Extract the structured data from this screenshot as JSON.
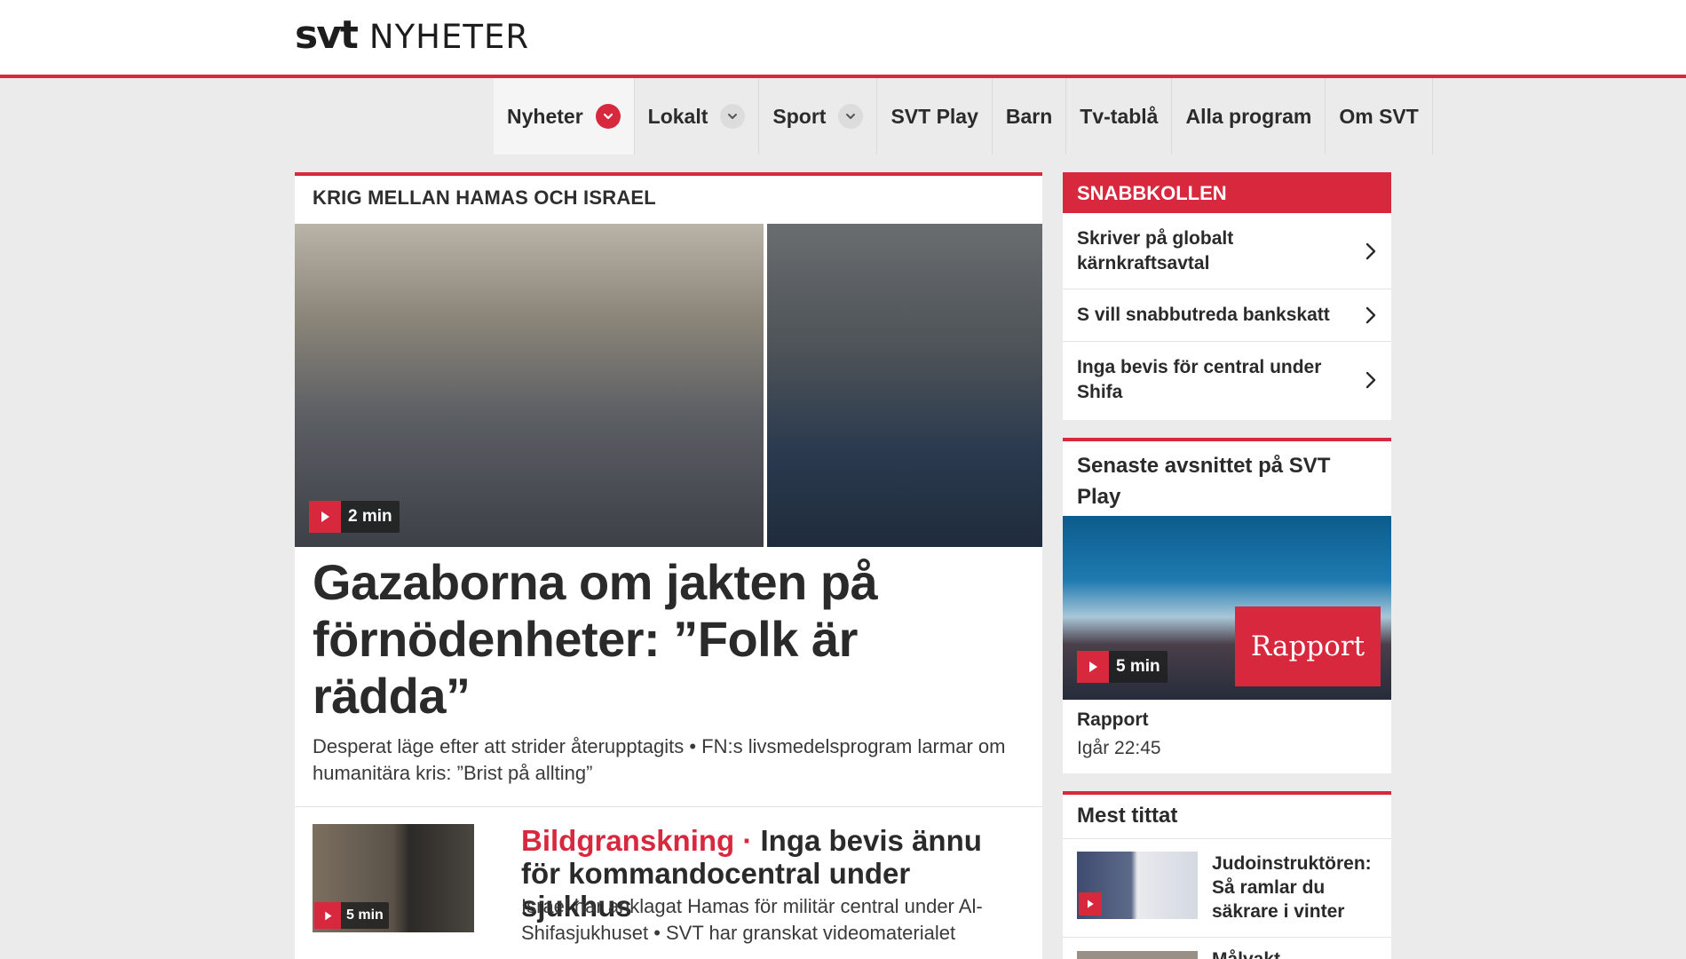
{
  "header": {
    "logo_svt": "svt",
    "logo_section": "NYHETER"
  },
  "nav": {
    "items": [
      {
        "label": "Nyheter"
      },
      {
        "label": "Lokalt"
      },
      {
        "label": "Sport"
      },
      {
        "label": "SVT Play"
      },
      {
        "label": "Barn"
      },
      {
        "label": "Tv-tablå"
      },
      {
        "label": "Alla program"
      },
      {
        "label": "Om SVT"
      }
    ]
  },
  "main": {
    "kicker": "KRIG MELLAN HAMAS OCH ISRAEL",
    "hero_duration": "2 min",
    "headline": "Gazaborna om jakten på förnödenheter: ”Folk är rädda”",
    "subtitle": "Desperat läge efter att strider återupptagits • FN:s livsmedelsprogram larmar om humanitära kris: ”Brist på allting”",
    "secondary": {
      "duration": "5 min",
      "tag": "Bildgranskning ·",
      "title": "Inga bevis ännu för kommandocentral under sjukhus",
      "subtitle": "Israel har anklagat Hamas för militär central under Al-Shifasjukhuset • SVT har granskat videomaterialet"
    }
  },
  "snabbkollen": {
    "header": "SNABBKOLLEN",
    "items": [
      {
        "label": "Skriver på globalt kärnkraftsavtal"
      },
      {
        "label": "S vill snabbutreda bankskatt"
      },
      {
        "label": "Inga bevis för central under Shifa"
      }
    ]
  },
  "svtplay": {
    "title": "Senaste avsnittet på SVT Play",
    "overlay": "Rapport",
    "duration": "5 min",
    "program": "Rapport",
    "time": "Igår 22:45"
  },
  "mest_tittat": {
    "title": "Mest tittat",
    "items": [
      {
        "label": "Judoinstruktören: Så ramlar du säkrare i vinter"
      },
      {
        "label": "Målvakt..."
      }
    ]
  },
  "colors": {
    "accent": "#d7283e",
    "background": "#ebebeb"
  }
}
